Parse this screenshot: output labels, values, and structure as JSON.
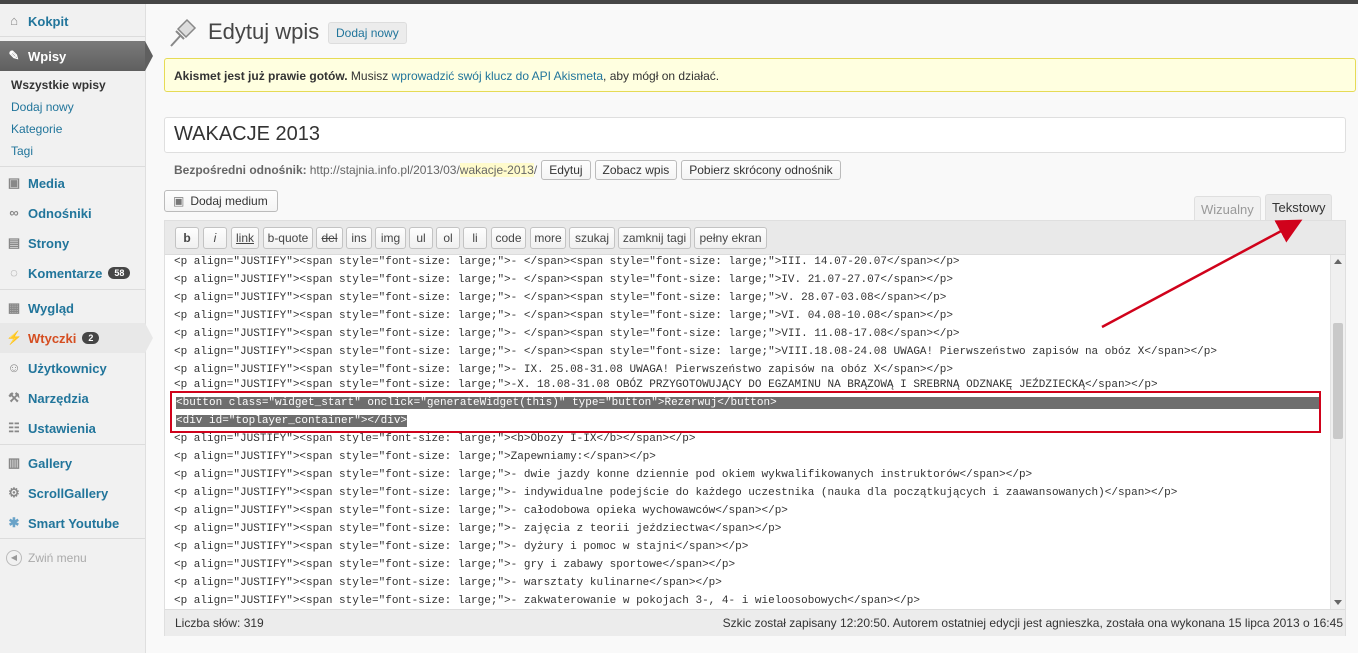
{
  "sidebar": {
    "items": [
      {
        "label": "Kokpit",
        "icon": "dashboard-icon"
      },
      {
        "label": "Wpisy",
        "icon": "pin-icon"
      },
      {
        "label": "Media",
        "icon": "media-icon"
      },
      {
        "label": "Odnośniki",
        "icon": "link-icon"
      },
      {
        "label": "Strony",
        "icon": "pages-icon"
      },
      {
        "label": "Komentarze",
        "icon": "comments-icon",
        "badge": "58"
      },
      {
        "label": "Wygląd",
        "icon": "appearance-icon"
      },
      {
        "label": "Wtyczki",
        "icon": "plugins-icon",
        "badge": "2"
      },
      {
        "label": "Użytkownicy",
        "icon": "users-icon"
      },
      {
        "label": "Narzędzia",
        "icon": "tools-icon"
      },
      {
        "label": "Ustawienia",
        "icon": "settings-icon"
      },
      {
        "label": "Gallery",
        "icon": "gallery-icon"
      },
      {
        "label": "ScrollGallery",
        "icon": "scrollgallery-icon"
      },
      {
        "label": "Smart Youtube",
        "icon": "youtube-icon"
      }
    ],
    "submenu": [
      "Wszystkie wpisy",
      "Dodaj nowy",
      "Kategorie",
      "Tagi"
    ],
    "collapse_label": "Zwiń menu"
  },
  "header": {
    "title": "Edytuj wpis",
    "add_new": "Dodaj nowy"
  },
  "notice": {
    "bold": "Akismet jest już prawie gotów.",
    "before_link": " Musisz ",
    "link": "wprowadzić swój klucz do API Akismeta",
    "after_link": ", aby mógł on działać."
  },
  "post": {
    "title": "WAKACJE 2013",
    "permalink_label": "Bezpośredni odnośnik:",
    "permalink_base": "http://stajnia.info.pl/2013/03/",
    "permalink_slug": "wakacje-2013",
    "permalink_end": "/",
    "edit_btn": "Edytuj",
    "view_btn": "Zobacz wpis",
    "shortlink_btn": "Pobierz skrócony odnośnik"
  },
  "editor": {
    "add_media": "Dodaj medium",
    "tab_visual": "Wizualny",
    "tab_text": "Tekstowy",
    "quicktags": [
      "b",
      "i",
      "link",
      "b-quote",
      "del",
      "ins",
      "img",
      "ul",
      "ol",
      "li",
      "code",
      "more",
      "szukaj",
      "zamknij tagi",
      "pełny ekran"
    ],
    "lines": [
      "<p align=\"JUSTIFY\"><span style=\"font-size: large;\">- </span><span style=\"font-size: large;\">III. 14.07-20.07</span></p>",
      "<p align=\"JUSTIFY\"><span style=\"font-size: large;\">- </span><span style=\"font-size: large;\">IV. 21.07-27.07</span></p>",
      "<p align=\"JUSTIFY\"><span style=\"font-size: large;\">- </span><span style=\"font-size: large;\">V. 28.07-03.08</span></p>",
      "<p align=\"JUSTIFY\"><span style=\"font-size: large;\">- </span><span style=\"font-size: large;\">VI. 04.08-10.08</span></p>",
      "<p align=\"JUSTIFY\"><span style=\"font-size: large;\">- </span><span style=\"font-size: large;\">VII. 11.08-17.08</span></p>",
      "<p align=\"JUSTIFY\"><span style=\"font-size: large;\">- </span><span style=\"font-size: large;\">VIII.18.08-24.08 UWAGA! Pierwszeństwo zapisów na obóz X</span></p>",
      "<p align=\"JUSTIFY\"><span style=\"font-size: large;\">- IX. 25.08-31.08 UWAGA! Pierwszeństwo zapisów na obóz X</span></p>",
      "<p align=\"JUSTIFY\"><span style=\"font-size: large;\">-X. 18.08-31.08 OBÓZ PRZYGOTOWUJĄCY DO EGZAMINU NA BRĄZOWĄ I SREBRNĄ ODZNAKĘ JEŹDZIECKĄ</span></p>",
      "<button class=\"widget_start\" onclick=\"generateWidget(this)\" type=\"button\">Rezerwuj</button>",
      "<div id=\"toplayer_container\"></div>",
      "<p align=\"JUSTIFY\"><span style=\"font-size: large;\"><b>Obozy I-IX</b></span></p>",
      "<p align=\"JUSTIFY\"><span style=\"font-size: large;\">Zapewniamy:</span></p>",
      "<p align=\"JUSTIFY\"><span style=\"font-size: large;\">- dwie jazdy konne dziennie pod okiem wykwalifikowanych instruktorów</span></p>",
      "<p align=\"JUSTIFY\"><span style=\"font-size: large;\">- indywidualne podejście do każdego uczestnika (nauka dla początkujących i zaawansowanych)</span></p>",
      "<p align=\"JUSTIFY\"><span style=\"font-size: large;\">- całodobowa opieka wychowawców</span></p>",
      "<p align=\"JUSTIFY\"><span style=\"font-size: large;\">- zajęcia z teorii jeździectwa</span></p>",
      "<p align=\"JUSTIFY\"><span style=\"font-size: large;\">- dyżury i pomoc w stajni</span></p>",
      "<p align=\"JUSTIFY\"><span style=\"font-size: large;\">- gry i zabawy sportowe</span></p>",
      "<p align=\"JUSTIFY\"><span style=\"font-size: large;\">- warsztaty kulinarne</span></p>",
      "<p align=\"JUSTIFY\"><span style=\"font-size: large;\">- zakwaterowanie w pokojach 3-, 4- i wieloosobowych</span></p>"
    ],
    "word_count": "Liczba słów: 319",
    "draft_status": "Szkic został zapisany 12:20:50. Autorem ostatniej edycji jest agnieszka, została ona wykonana 15 lipca 2013 o 16:45"
  },
  "colors": {
    "annotation": "#d0021b",
    "link": "#21759b",
    "plugin_menu": "#d54e21"
  }
}
